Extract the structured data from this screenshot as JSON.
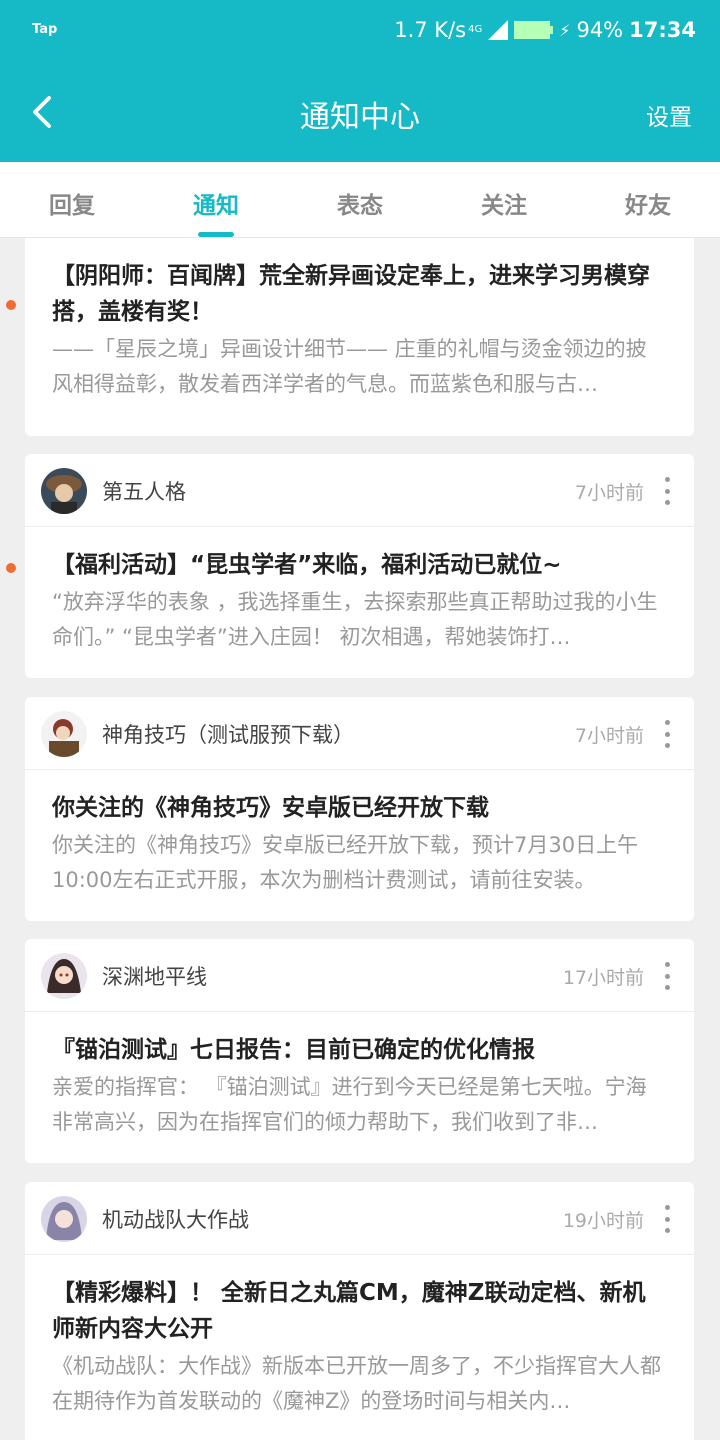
{
  "status_bar": {
    "app_label": "Tap",
    "speed": "1.7 K/s",
    "network": "4G",
    "battery": "94%",
    "time": "17:34",
    "colors": {
      "bar": "#16b9c6",
      "battery": "#b6ffb6"
    }
  },
  "header": {
    "title": "通知中心",
    "settings_label": "设置"
  },
  "tabs": [
    {
      "label": "回复",
      "active": false
    },
    {
      "label": "通知",
      "active": true
    },
    {
      "label": "表态",
      "active": false
    },
    {
      "label": "关注",
      "active": false
    },
    {
      "label": "好友",
      "active": false
    }
  ],
  "notifications": [
    {
      "title": "【阴阳师：百闻牌】荒全新异画设定奉上，进来学习男模穿搭，盖楼有奖！",
      "excerpt": "——「星辰之境」异画设计细节—— 庄重的礼帽与烫金领边的披风相得益彰，散发着西洋学者的气息。而蓝紫色和服与古…",
      "unread": true
    },
    {
      "source": "第五人格",
      "time": "7小时前",
      "title": "【福利活动】“昆虫学者”来临，福利活动已就位~",
      "excerpt": "“放弃浮华的表象 ，我选择重生，去探索那些真正帮助过我的小生命们。” “昆虫学者”进入庄园！ 初次相遇，帮她装饰打…",
      "unread": true
    },
    {
      "source": "神角技巧（测试服预下载）",
      "time": "7小时前",
      "title": "你关注的《神角技巧》安卓版已经开放下载",
      "excerpt": "你关注的《神角技巧》安卓版已经开放下载，预计7月30日上午10:00左右正式开服，本次为删档计费测试，请前往安装。",
      "unread": false
    },
    {
      "source": "深渊地平线",
      "time": "17小时前",
      "title": "『锚泊测试』七日报告：目前已确定的优化情报",
      "excerpt": "亲爱的指挥官： 『锚泊测试』进行到今天已经是第七天啦。宁海非常高兴，因为在指挥官们的倾力帮助下，我们收到了非…",
      "unread": false
    },
    {
      "source": "机动战队大作战",
      "time": "19小时前",
      "title": "【精彩爆料】！ 全新日之丸篇CM，魔神Z联动定档、新机师新内容大公开",
      "excerpt": "《机动战队：大作战》新版本已开放一周多了，不少指挥官大人都在期待作为首发联动的《魔神Z》的登场时间与相关内…",
      "unread": false
    }
  ]
}
